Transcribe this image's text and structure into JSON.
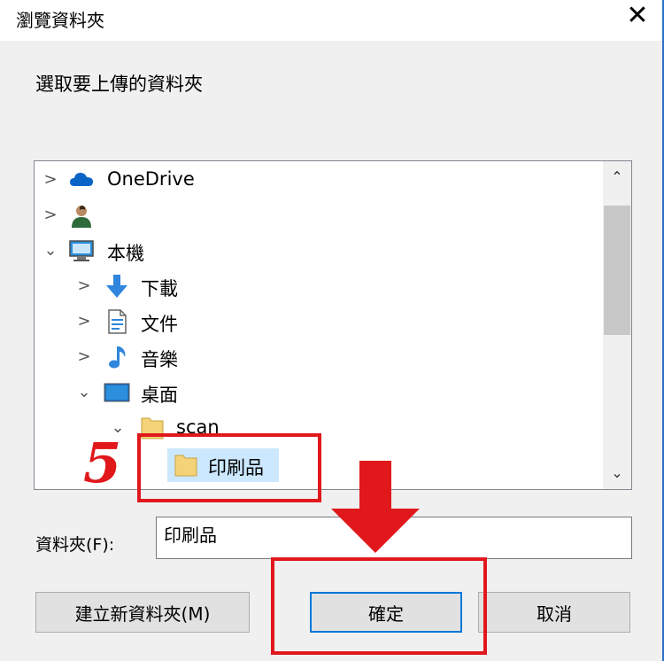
{
  "window": {
    "title": "瀏覽資料夾",
    "close_icon": "close-icon"
  },
  "prompt": "選取要上傳的資料夾",
  "tree": {
    "items": [
      {
        "label": "OneDrive",
        "icon": "onedrive-cloud-icon",
        "expanded": false
      },
      {
        "label": "",
        "icon": "user-icon",
        "expanded": false
      },
      {
        "label": "本機",
        "icon": "computer-icon",
        "expanded": true
      },
      {
        "label": "下載",
        "icon": "download-icon",
        "expanded": false
      },
      {
        "label": "文件",
        "icon": "document-icon",
        "expanded": false
      },
      {
        "label": "音樂",
        "icon": "music-icon",
        "expanded": false
      },
      {
        "label": "桌面",
        "icon": "desktop-icon",
        "expanded": true
      },
      {
        "label": "scan",
        "icon": "folder-icon",
        "expanded": true
      },
      {
        "label": "印刷品",
        "icon": "folder-icon",
        "selected": true
      }
    ]
  },
  "folder_field": {
    "label": "資料夾(F):",
    "value": "印刷品"
  },
  "buttons": {
    "new_folder": "建立新資料夾(M)",
    "ok": "確定",
    "cancel": "取消"
  },
  "annotation": {
    "step_number": "5"
  },
  "colors": {
    "annotation_red": "#e0181b",
    "selection": "#cce8ff",
    "accent": "#0078d7"
  }
}
